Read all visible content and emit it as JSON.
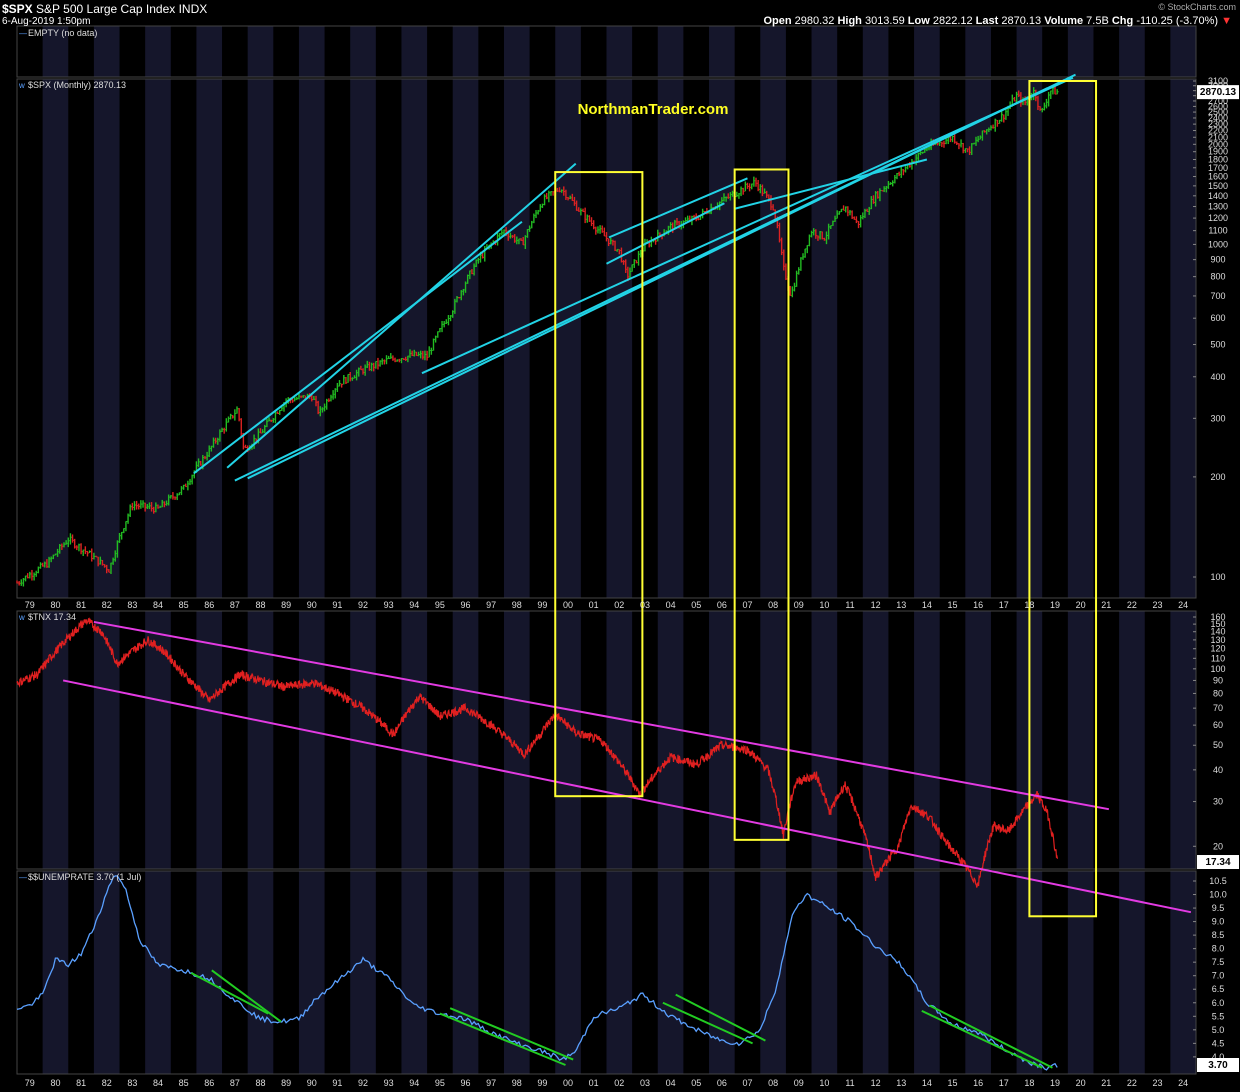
{
  "header": {
    "symbol": "$SPX",
    "name": "S&P 500 Large Cap Index",
    "exchange": "INDX",
    "date": "6-Aug-2019 1:50pm",
    "watermark": "© StockCharts.com",
    "quote": [
      {
        "label": "Open",
        "value": "2980.32"
      },
      {
        "label": "High",
        "value": "3013.59"
      },
      {
        "label": "Low",
        "value": "2822.12"
      },
      {
        "label": "Last",
        "value": "2870.13"
      },
      {
        "label": "Volume",
        "value": "7.5B"
      },
      {
        "label": "Chg",
        "value": "-110.25 (-3.70%)"
      }
    ]
  },
  "colors": {
    "background": "#000000",
    "band": "#15162b",
    "up": "#22bb22",
    "down": "#dd2222",
    "trendline": "#22d3e6",
    "yellow_box": "#ffff33",
    "tnx_channel": "#e33be3",
    "tnx_line": "#e02020",
    "unemp_line": "#5aa0ff",
    "unemp_trend": "#22cc22"
  },
  "chart_data": [
    {
      "type": "table",
      "panel": "empty",
      "title": "EMPTY (no data)",
      "values": []
    },
    {
      "type": "line",
      "panel": "spx",
      "title": "$SPX (Monthly) 2870.13",
      "watermark_text": "NorthmanTrader.com",
      "last_value": "2870.13",
      "yscale": "log",
      "ylim": [
        85,
        3150
      ],
      "xlim": [
        1979.0,
        2025.0
      ],
      "y_ticks": [
        100,
        200,
        300,
        400,
        500,
        600,
        700,
        800,
        900,
        1000,
        1100,
        1200,
        1300,
        1400,
        1500,
        1600,
        1700,
        1800,
        1900,
        2000,
        2100,
        2200,
        2300,
        2400,
        2500,
        2600,
        2700,
        2800,
        2900,
        3000,
        3100
      ],
      "y_tick_labels": [
        "100",
        "200",
        "300",
        "400",
        "500",
        "600",
        "700",
        "800",
        "900",
        "1000",
        "1100",
        "1200",
        "1300",
        "1400",
        "1500",
        "1600",
        "1700",
        "1800",
        "1900",
        "2000",
        "2100",
        "2200",
        "2300",
        "2400",
        "2500",
        "2600",
        "2700",
        "2800",
        "2900",
        "3000",
        "3100"
      ],
      "x_tick_labels": [
        "79",
        "80",
        "81",
        "82",
        "83",
        "84",
        "85",
        "86",
        "87",
        "88",
        "89",
        "90",
        "91",
        "92",
        "93",
        "94",
        "95",
        "96",
        "97",
        "98",
        "99",
        "00",
        "01",
        "02",
        "03",
        "04",
        "05",
        "06",
        "07",
        "08",
        "09",
        "10",
        "11",
        "12",
        "13",
        "14",
        "15",
        "16",
        "17",
        "18",
        "19",
        "20",
        "21",
        "22",
        "23",
        "24"
      ],
      "series": [
        {
          "x": [
            1979.0,
            1980.2,
            1981.0,
            1982.6,
            1983.5,
            1984.5,
            1985.5,
            1986.5,
            1987.6,
            1987.85,
            1988.5,
            1989.5,
            1990.5,
            1990.8,
            1991.5,
            1992.5,
            1993.5,
            1994.5,
            1995.0,
            1996.0,
            1997.0,
            1998.0,
            1998.7,
            1999.5,
            2000.2,
            2001.0,
            2001.7,
            2002.5,
            2002.8,
            2003.5,
            2004.5,
            2005.5,
            2006.5,
            2007.8,
            2008.5,
            2008.9,
            2009.2,
            2010.0,
            2010.5,
            2011.3,
            2011.8,
            2012.5,
            2013.5,
            2014.5,
            2015.5,
            2016.1,
            2016.8,
            2017.5,
            2018.0,
            2018.3,
            2018.7,
            2018.95,
            2019.3,
            2019.6
          ],
          "y": [
            96,
            110,
            130,
            105,
            165,
            160,
            185,
            240,
            320,
            240,
            270,
            340,
            350,
            310,
            380,
            420,
            450,
            465,
            460,
            640,
            900,
            1100,
            1000,
            1350,
            1480,
            1250,
            1100,
            950,
            800,
            990,
            1130,
            1200,
            1350,
            1540,
            1300,
            850,
            700,
            1100,
            1050,
            1300,
            1150,
            1400,
            1650,
            1950,
            2100,
            1900,
            2200,
            2450,
            2800,
            2650,
            2900,
            2450,
            2900,
            2870
          ]
        }
      ],
      "trendlines": [
        {
          "x": [
            1985.9,
            1998.7
          ],
          "y": [
            205,
            1170
          ]
        },
        {
          "x": [
            1987.2,
            2000.8
          ],
          "y": [
            213,
            1750
          ]
        },
        {
          "x": [
            1988.0,
            2019.2
          ],
          "y": [
            198,
            2950
          ]
        },
        {
          "x": [
            1987.5,
            2020.3
          ],
          "y": [
            195,
            3240
          ]
        },
        {
          "x": [
            1994.8,
            2020.2
          ],
          "y": [
            410,
            3170
          ]
        },
        {
          "x": [
            2002.0,
            2006.6
          ],
          "y": [
            875,
            1330
          ]
        },
        {
          "x": [
            2002.1,
            2007.5
          ],
          "y": [
            1050,
            1580
          ]
        },
        {
          "x": [
            2007.0,
            2014.5
          ],
          "y": [
            1280,
            1800
          ]
        }
      ]
    },
    {
      "type": "line",
      "panel": "tnx",
      "title": "$TNX 17.34",
      "last_value": "17.34",
      "yscale": "log",
      "ylim": [
        15,
        165
      ],
      "xlim": [
        1979.0,
        2025.0
      ],
      "y_ticks": [
        20,
        30,
        40,
        50,
        60,
        70,
        80,
        90,
        100,
        110,
        120,
        130,
        140,
        150,
        160
      ],
      "y_tick_labels": [
        "20",
        "30",
        "40",
        "50",
        "60",
        "70",
        "80",
        "90",
        "100",
        "110",
        "120",
        "130",
        "140",
        "150",
        "160"
      ],
      "series": [
        {
          "x": [
            1979.0,
            1979.8,
            1980.6,
            1981.7,
            1982.3,
            1982.9,
            1984.1,
            1984.7,
            1985.5,
            1986.5,
            1987.7,
            1988.5,
            1989.4,
            1990.6,
            1991.5,
            1992.5,
            1993.7,
            1994.7,
            1995.5,
            1996.5,
            1997.5,
            1998.8,
            1999.4,
            2000.0,
            2000.8,
            2001.8,
            2002.7,
            2003.3,
            2004.5,
            2005.5,
            2006.5,
            2007.5,
            2008.3,
            2008.9,
            2009.4,
            2010.2,
            2010.7,
            2011.3,
            2012.5,
            2013.4,
            2013.9,
            2014.6,
            2015.2,
            2016.5,
            2017.1,
            2017.7,
            2018.8,
            2019.2,
            2019.6
          ],
          "y": [
            88,
            95,
            120,
            155,
            140,
            105,
            130,
            118,
            95,
            75,
            95,
            90,
            85,
            88,
            80,
            70,
            55,
            78,
            65,
            70,
            60,
            46,
            55,
            66,
            56,
            52,
            40,
            32,
            45,
            42,
            50,
            48,
            40,
            22,
            36,
            38,
            27,
            35,
            15,
            20,
            29,
            26,
            21,
            14,
            24,
            23,
            32,
            27,
            17.34
          ]
        }
      ],
      "trendlines": [
        {
          "x": [
            1982.0,
            2021.6
          ],
          "y": [
            153,
            28
          ]
        },
        {
          "x": [
            1980.8,
            2024.8
          ],
          "y": [
            90,
            11
          ]
        }
      ]
    },
    {
      "type": "line",
      "panel": "unemployment",
      "title": "$$UNEMPRATE 3.70 (1 Jul)",
      "last_value": "3.70",
      "ylim": [
        3.5,
        10.9
      ],
      "xlim": [
        1979.0,
        2025.0
      ],
      "y_ticks": [
        4.0,
        4.5,
        5.0,
        5.5,
        6.0,
        6.5,
        7.0,
        7.5,
        8.0,
        8.5,
        9.0,
        9.5,
        10.0,
        10.5
      ],
      "y_tick_labels": [
        "4.0",
        "4.5",
        "5.0",
        "5.5",
        "6.0",
        "6.5",
        "7.0",
        "7.5",
        "8.0",
        "8.5",
        "9.0",
        "9.5",
        "10.0",
        "10.5"
      ],
      "x_tick_labels": [
        "79",
        "80",
        "81",
        "82",
        "83",
        "84",
        "85",
        "86",
        "87",
        "88",
        "89",
        "90",
        "91",
        "92",
        "93",
        "94",
        "95",
        "96",
        "97",
        "98",
        "99",
        "00",
        "01",
        "02",
        "03",
        "04",
        "05",
        "06",
        "07",
        "08",
        "09",
        "10",
        "11",
        "12",
        "13",
        "14",
        "15",
        "16",
        "17",
        "18",
        "19",
        "20",
        "21",
        "22",
        "23",
        "24"
      ],
      "series": [
        {
          "x": [
            1979.0,
            1979.5,
            1980.0,
            1980.5,
            1981.0,
            1981.5,
            1982.0,
            1982.8,
            1983.2,
            1983.8,
            1984.5,
            1985.5,
            1986.5,
            1987.5,
            1988.5,
            1989.3,
            1990.0,
            1990.6,
            1991.5,
            1992.5,
            1993.5,
            1994.5,
            1995.5,
            1996.5,
            1997.5,
            1998.5,
            1999.5,
            2000.3,
            2000.8,
            2001.5,
            2002.5,
            2003.4,
            2004.5,
            2005.5,
            2006.5,
            2007.2,
            2008.0,
            2008.6,
            2009.3,
            2009.8,
            2010.5,
            2011.5,
            2012.5,
            2013.5,
            2014.5,
            2015.5,
            2016.5,
            2017.5,
            2018.5,
            2019.2,
            2019.6
          ],
          "y": [
            5.8,
            5.9,
            6.3,
            7.6,
            7.4,
            7.8,
            8.8,
            10.8,
            10.3,
            8.3,
            7.4,
            7.2,
            6.9,
            6.1,
            5.4,
            5.3,
            5.4,
            6.1,
            6.8,
            7.6,
            6.9,
            5.9,
            5.6,
            5.4,
            4.9,
            4.5,
            4.2,
            3.9,
            4.2,
            5.5,
            5.8,
            6.3,
            5.5,
            5.0,
            4.6,
            4.5,
            5.0,
            6.5,
            9.4,
            10.0,
            9.6,
            9.0,
            8.1,
            7.4,
            6.0,
            5.2,
            4.9,
            4.3,
            3.8,
            3.6,
            3.7
          ]
        }
      ],
      "trendlines": [
        {
          "x": [
            1985.8,
            1988.8
          ],
          "y": [
            7.1,
            5.6
          ]
        },
        {
          "x": [
            1986.6,
            1989.3
          ],
          "y": [
            7.2,
            5.3
          ]
        },
        {
          "x": [
            1995.5,
            2000.4
          ],
          "y": [
            5.6,
            3.7
          ]
        },
        {
          "x": [
            1995.9,
            2000.7
          ],
          "y": [
            5.8,
            3.9
          ]
        },
        {
          "x": [
            2004.2,
            2007.7
          ],
          "y": [
            6.0,
            4.5
          ]
        },
        {
          "x": [
            2004.7,
            2008.2
          ],
          "y": [
            6.3,
            4.6
          ]
        },
        {
          "x": [
            2014.3,
            2019.0
          ],
          "y": [
            5.7,
            3.6
          ]
        },
        {
          "x": [
            2014.6,
            2019.4
          ],
          "y": [
            5.9,
            3.6
          ]
        }
      ]
    }
  ],
  "highlight_boxes": [
    {
      "x": [
        2000.0,
        2003.4
      ],
      "spx_top": 1650,
      "tnx_bottom": 31.5
    },
    {
      "x": [
        2007.0,
        2009.1
      ],
      "spx_top": 1680,
      "tnx_bottom": 21.2
    },
    {
      "x": [
        2018.5,
        2021.1
      ],
      "spx_top": 3100,
      "tnx_bottom": 10.6
    }
  ]
}
